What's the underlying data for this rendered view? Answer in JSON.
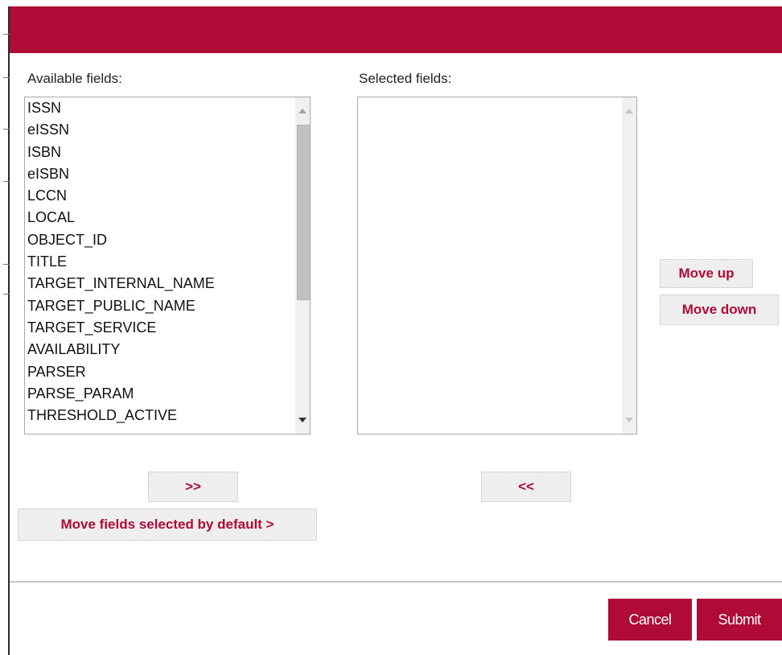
{
  "colors": {
    "brand": "#b00a36",
    "button_bg": "#ececec",
    "divider": "#c9c9c9"
  },
  "available": {
    "label": "Available fields:",
    "items": [
      "ISSN",
      "eISSN",
      "ISBN",
      "eISBN",
      "LCCN",
      "LOCAL",
      "OBJECT_ID",
      "TITLE",
      "TARGET_INTERNAL_NAME",
      "TARGET_PUBLIC_NAME",
      "TARGET_SERVICE",
      "AVAILABILITY",
      "PARSER",
      "PARSE_PARAM",
      "THRESHOLD_ACTIVE"
    ]
  },
  "selected": {
    "label": "Selected fields:",
    "items": []
  },
  "buttons": {
    "move_right": ">>",
    "move_left": "<<",
    "move_default": "Move fields selected by default >",
    "move_up": "Move up",
    "move_down": "Move down",
    "cancel": "Cancel",
    "submit": "Submit"
  },
  "icons": {
    "scroll_up": "triangle-up",
    "scroll_down": "triangle-down"
  }
}
